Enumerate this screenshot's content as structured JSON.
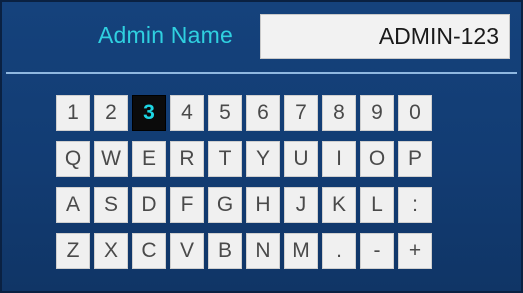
{
  "header": {
    "title": "Admin Name",
    "name_value": "ADMIN-123"
  },
  "keyboard": {
    "selected_key": "3",
    "rows": [
      [
        "1",
        "2",
        "3",
        "4",
        "5",
        "6",
        "7",
        "8",
        "9",
        "0"
      ],
      [
        "Q",
        "W",
        "E",
        "R",
        "T",
        "Y",
        "U",
        "I",
        "O",
        "P"
      ],
      [
        "A",
        "S",
        "D",
        "F",
        "G",
        "H",
        "J",
        "K",
        "L",
        ":"
      ],
      [
        "Z",
        "X",
        "C",
        "V",
        "B",
        "N",
        "M",
        ".",
        "-",
        "+"
      ]
    ]
  },
  "colors": {
    "background": "#15427c",
    "title": "#2fd0e0",
    "selected_key_bg": "#0b0b0b",
    "selected_key_text": "#1dd6e3",
    "key_bg": "#f0f0f0"
  }
}
